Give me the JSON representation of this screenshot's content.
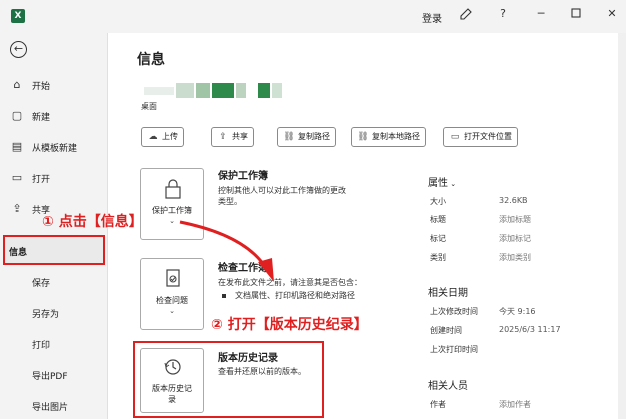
{
  "window": {
    "app_icon": "X",
    "login_label": "登录",
    "icons": [
      "pen-icon",
      "help-icon",
      "minimize-icon",
      "maximize-icon",
      "close-icon"
    ]
  },
  "sidebar": {
    "back_icon": "←",
    "items": [
      {
        "label": "开始",
        "icon": "⌂"
      },
      {
        "label": "新建",
        "icon": "▢"
      },
      {
        "label": "从模板新建",
        "icon": "▤"
      },
      {
        "label": "打开",
        "icon": "▭"
      },
      {
        "label": "共享",
        "icon": "⇪"
      },
      {
        "label": "信息",
        "icon": ""
      },
      {
        "label": "保存",
        "icon": ""
      },
      {
        "label": "另存为",
        "icon": ""
      },
      {
        "label": "打印",
        "icon": ""
      },
      {
        "label": "导出PDF",
        "icon": ""
      },
      {
        "label": "导出图片",
        "icon": ""
      }
    ]
  },
  "main": {
    "title": "信息",
    "path_label": "桌面",
    "toolbar": [
      {
        "label": "上传",
        "icon": "☁"
      },
      {
        "label": "共享",
        "icon": "⇪"
      },
      {
        "label": "复制路径",
        "icon": "⛓"
      },
      {
        "label": "复制本地路径",
        "icon": "⛓"
      },
      {
        "label": "打开文件位置",
        "icon": "▭"
      }
    ],
    "protect": {
      "card_label": "保护工作簿",
      "card_caret": "⌄",
      "title": "保护工作簿",
      "desc_line1": "控制其他人可以对此工作簿做的更改",
      "desc_line2": "类型。"
    },
    "inspect": {
      "card_label": "检查问题",
      "card_caret": "⌄",
      "title": "检查工作簿",
      "desc": "在发布此文件之前，请注意其是否包含：",
      "bullet": "文档属性、打印机路径和绝对路径"
    },
    "history": {
      "card_label_1": "版本历史记",
      "card_label_2": "录",
      "title": "版本历史记录",
      "desc": "查看并还原以前的版本。"
    }
  },
  "properties": {
    "head": "属性",
    "rows": [
      {
        "key": "大小",
        "value": "32.6KB"
      },
      {
        "key": "标题",
        "value": "添加标题"
      },
      {
        "key": "标记",
        "value": "添加标记"
      },
      {
        "key": "类别",
        "value": "添加类别"
      }
    ],
    "dates_head": "相关日期",
    "date_rows": [
      {
        "key": "上次修改时间",
        "value": "今天 9:16"
      },
      {
        "key": "创建时间",
        "value": "2025/6/3 11:17"
      },
      {
        "key": "上次打印时间",
        "value": ""
      }
    ],
    "people_head": "相关人员",
    "people_rows": [
      {
        "key": "作者",
        "value": "添加作者"
      }
    ]
  },
  "annotations": {
    "step1": "① 点击【信息】",
    "step2": "② 打开【版本历史纪录】",
    "color": "#e02020"
  }
}
